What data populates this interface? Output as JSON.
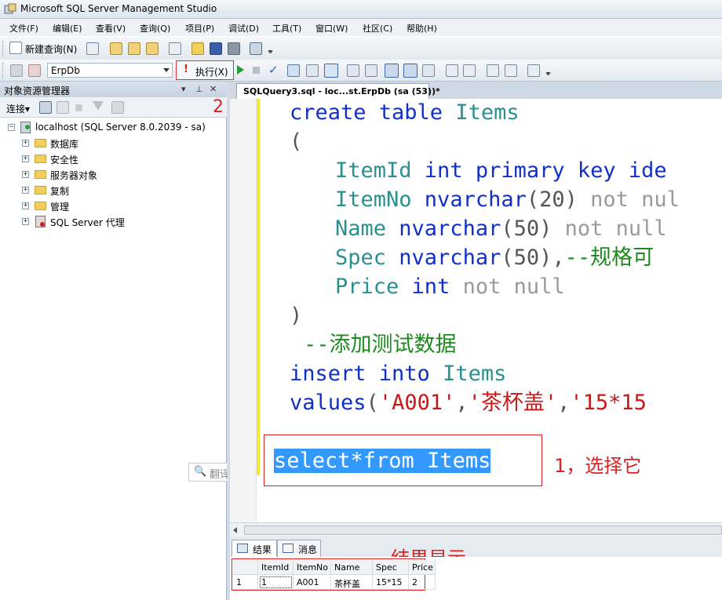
{
  "window": {
    "title": "Microsoft SQL Server Management Studio"
  },
  "menu": [
    "文件(F)",
    "编辑(E)",
    "查看(V)",
    "查询(Q)",
    "项目(P)",
    "调试(D)",
    "工具(T)",
    "窗口(W)",
    "社区(C)",
    "帮助(H)"
  ],
  "toolbar": {
    "new_query": "新建查询(N)",
    "database": "ErpDb",
    "execute": "执行(X)"
  },
  "object_explorer": {
    "title": "对象资源管理器",
    "connect": "连接",
    "server": "localhost (SQL Server 8.0.2039 - sa)",
    "nodes": [
      "数据库",
      "安全性",
      "服务器对象",
      "复制",
      "管理",
      "SQL Server 代理"
    ]
  },
  "editor": {
    "tab": "SQLQuery3.sql - loc...st.ErpDb (sa (53))*",
    "lines": {
      "l1_kw": "create table",
      "l1_id": " Items",
      "l2": "(",
      "l3_id": "ItemId",
      "l3_kw": " int primary key ide",
      "l4_id": "ItemNo",
      "l4_kw": " nvarchar",
      "l4_dark": "(20)",
      "l4_gray": " not nul",
      "l5_id": "Name",
      "l5_kw": " nvarchar",
      "l5_dark": "(50)",
      "l5_gray": " not null",
      "l6_id": "Spec",
      "l6_kw": " nvarchar",
      "l6_dark": "(50),",
      "l6_cmt": "--规格可",
      "l7_id": "Price",
      "l7_kw": " int",
      "l7_gray": " not null",
      "l8": ")",
      "l9": "--添加测试数据",
      "l10_kw": "insert into",
      "l10_id": " Items",
      "l11_kw": "values",
      "l11_dark1": "(",
      "l11_s1": "'A001'",
      "l11_c1": ",",
      "l11_s2": "'茶杯盖'",
      "l11_c2": ",",
      "l11_s3": "'15*15",
      "l12": "select*from Items"
    }
  },
  "annotations": {
    "step1": "1，选择它",
    "step2": "2",
    "result": "结果显示"
  },
  "watermark": "翻译",
  "results": {
    "tabs": [
      "结果",
      "消息"
    ],
    "columns": [
      "ItemId",
      "ItemNo",
      "Name",
      "Spec",
      "Price"
    ],
    "rows": [
      {
        "num": "1",
        "cells": [
          "1",
          "A001",
          "茶杯盖",
          "15*15",
          "2"
        ]
      }
    ]
  }
}
